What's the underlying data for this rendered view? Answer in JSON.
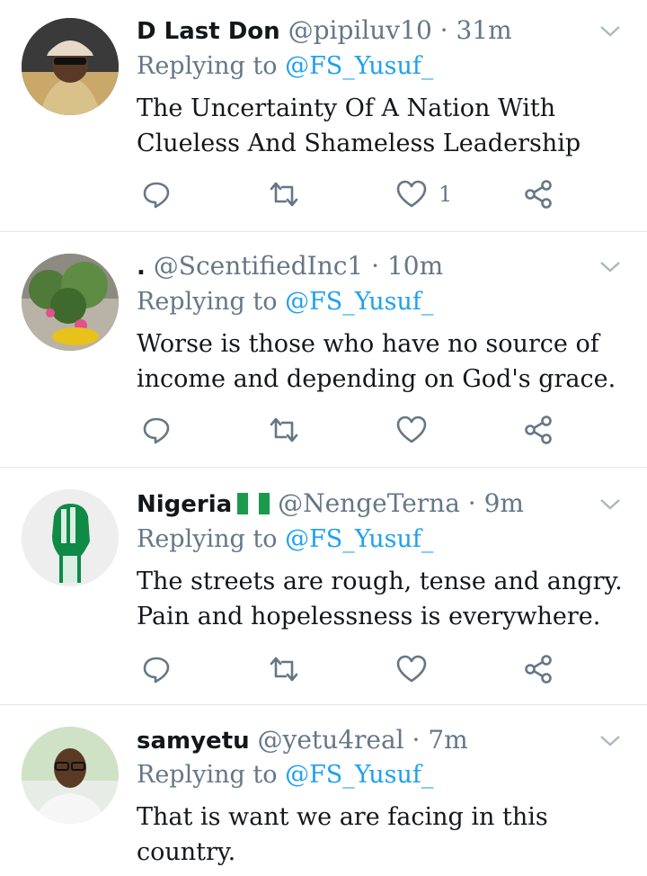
{
  "replies": [
    {
      "name": "D Last Don",
      "handle": "@pipiluv10",
      "time": "31m",
      "replying_label": "Replying to",
      "replying_to": "@FS_Yusuf_",
      "text_lines": [
        "The Uncertainty Of A Nation With",
        "Clueless And Shameless Leadership"
      ],
      "like_count": "1"
    },
    {
      "name": ".",
      "handle": "@ScentifiedInc1",
      "time": "10m",
      "replying_label": "Replying to",
      "replying_to": "@FS_Yusuf_",
      "text_lines": [
        "Worse is those who have no source of",
        "income and depending on God's grace."
      ],
      "like_count": ""
    },
    {
      "name": "Nigeria",
      "handle": "@NengeTerna",
      "time": "9m",
      "replying_label": "Replying to",
      "replying_to": "@FS_Yusuf_",
      "text_lines": [
        "The streets are rough, tense and angry.",
        "Pain and hopelessness is everywhere."
      ],
      "like_count": ""
    },
    {
      "name": "samyetu",
      "handle": "@yetu4real",
      "time": "7m",
      "replying_label": "Replying to",
      "replying_to": "@FS_Yusuf_",
      "text_lines": [
        "That is want we are facing in this",
        "country."
      ],
      "like_count": ""
    }
  ],
  "separator": "·",
  "colors": {
    "accent": "#1da1f2",
    "muted": "#657786",
    "text": "#14171a",
    "divider": "#e1e8ed"
  },
  "icons": [
    "reply-icon",
    "retweet-icon",
    "like-icon",
    "share-icon",
    "chevron-down-icon"
  ]
}
